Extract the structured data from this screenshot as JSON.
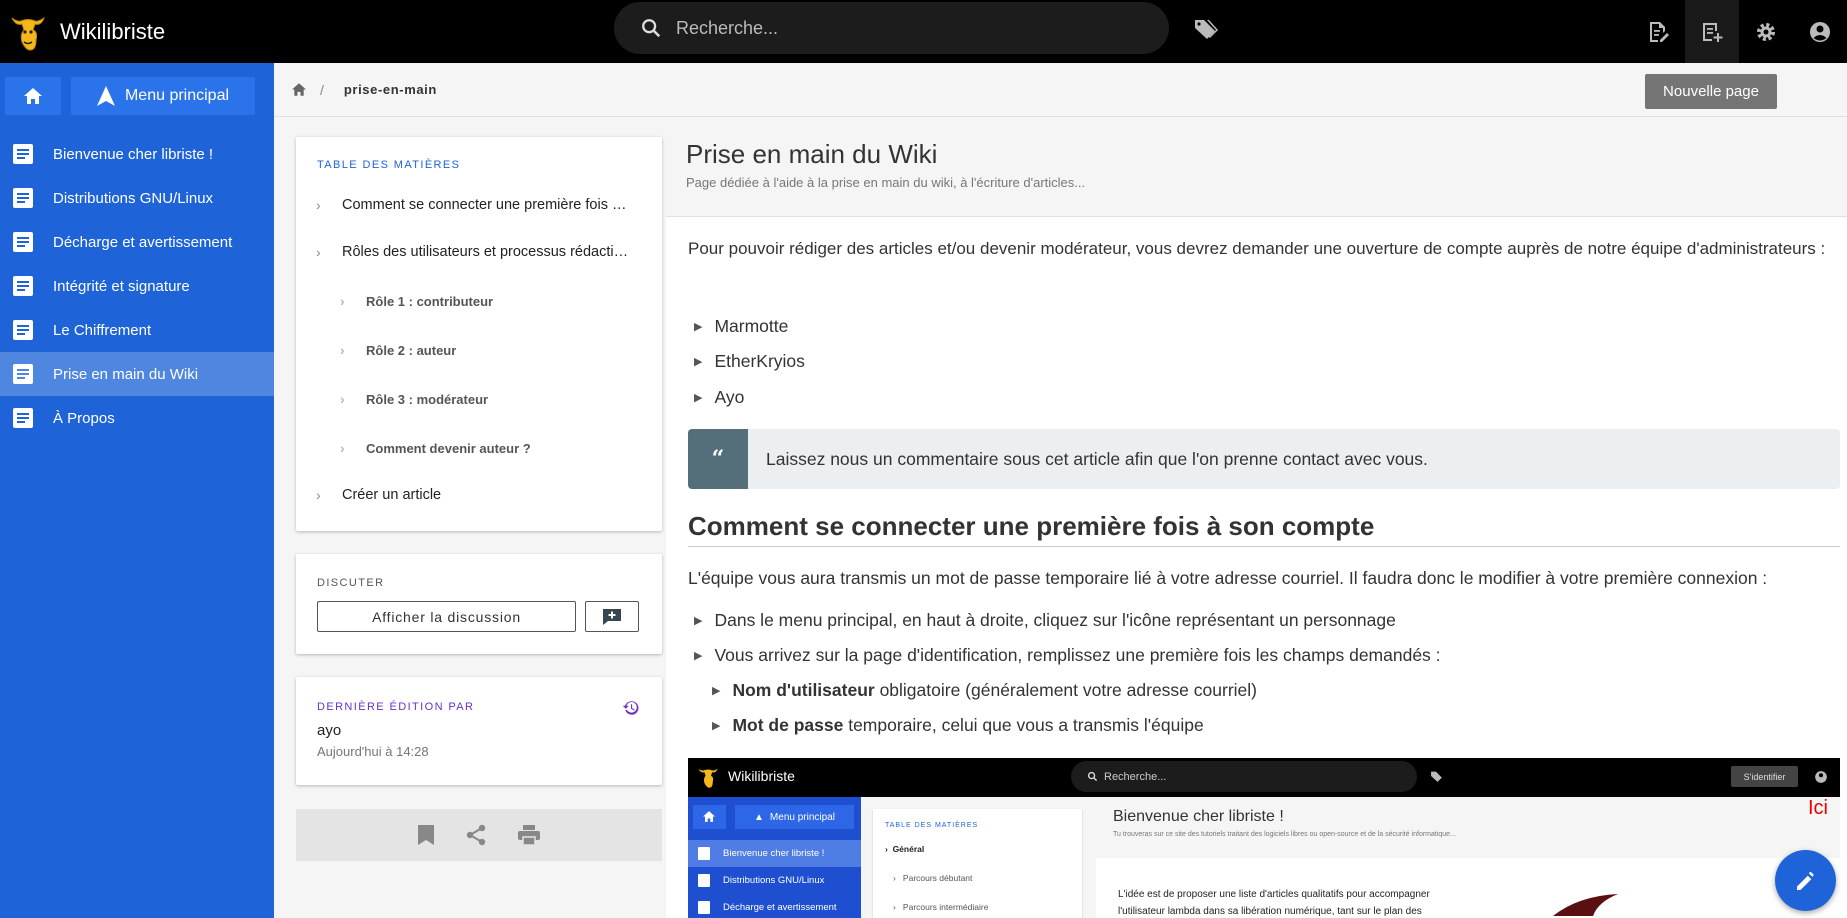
{
  "app": {
    "title": "Wikilibriste",
    "search_placeholder": "Recherche..."
  },
  "sidebar": {
    "menu_label": "Menu principal",
    "items": [
      {
        "label": "Bienvenue cher libriste !"
      },
      {
        "label": "Distributions GNU/Linux"
      },
      {
        "label": "Décharge et avertissement"
      },
      {
        "label": "Intégrité et signature"
      },
      {
        "label": "Le Chiffrement"
      },
      {
        "label": "Prise en main du Wiki",
        "active": true
      },
      {
        "label": "À Propos"
      }
    ]
  },
  "breadcrumb": {
    "path": "prise-en-main",
    "new_page_label": "Nouvelle page"
  },
  "toc": {
    "title": "TABLE DES MATIÈRES",
    "items": [
      {
        "label": "Comment se connecter une première fois à son compte"
      },
      {
        "label": "Rôles des utilisateurs et processus rédactionnel"
      },
      {
        "label": "Rôle 1 : contributeur"
      },
      {
        "label": "Rôle 2 : auteur"
      },
      {
        "label": "Rôle 3 : modérateur"
      },
      {
        "label": "Comment devenir auteur ?"
      },
      {
        "label": "Créer un article"
      }
    ]
  },
  "discuss": {
    "title": "DISCUTER",
    "button_label": "Afficher la discussion"
  },
  "last_edit": {
    "title": "DERNIÈRE ÉDITION PAR",
    "author": "ayo",
    "date": "Aujourd'hui à 14:28"
  },
  "page": {
    "title": "Prise en main du Wiki",
    "subtitle": "Page dédiée à l'aide à la prise en main du wiki, à l'écriture d'articles...",
    "intro": "Pour pouvoir rédiger des articles et/ou devenir modérateur, vous devrez demander une ouverture de compte auprès de notre équipe d'administrateurs :",
    "admins": [
      "Marmotte",
      "EtherKryios",
      "Ayo"
    ],
    "quote": "Laissez nous un commentaire sous cet article afin que l'on prenne contact avec vous.",
    "section_title": "Comment se connecter une première fois à son compte",
    "section_text": "L'équipe vous aura transmis un mot de passe temporaire lié à votre adresse courriel. Il faudra donc le modifier à votre première connexion :",
    "steps": [
      "Dans le menu principal, en haut à droite, cliquez sur l'icône représentant un personnage",
      "Vous arrivez sur la page d'identification, remplissez une première fois les champs demandés :"
    ],
    "substeps": [
      {
        "bold": "Nom d'utilisateur",
        "rest": " obligatoire (généralement votre adresse courriel)"
      },
      {
        "bold": "Mot de passe",
        "rest": " temporaire, celui que vous a transmis l'équipe"
      }
    ]
  },
  "screenshot": {
    "app_title": "Wikilibriste",
    "search": "Recherche...",
    "login": "S'identifier",
    "menu": "Menu principal",
    "nav": [
      "Bienvenue cher libriste !",
      "Distributions GNU/Linux",
      "Décharge et avertissement"
    ],
    "toc_title": "TABLE DES MATIÈRES",
    "toc_items": [
      "Général",
      "Parcours débutant",
      "Parcours intermédiaire"
    ],
    "title": "Bienvenue cher libriste !",
    "subtitle": "Tu trouveras sur ce site des tutoriels traitant des logiciels libres ou open-source et de la sécurité informatique...",
    "annotation": "Ici",
    "text": "L'idée est de proposer une liste d'articles qualitatifs pour accompagner l'utilisateur lambda dans sa libération numérique, tant sur le plan des"
  }
}
